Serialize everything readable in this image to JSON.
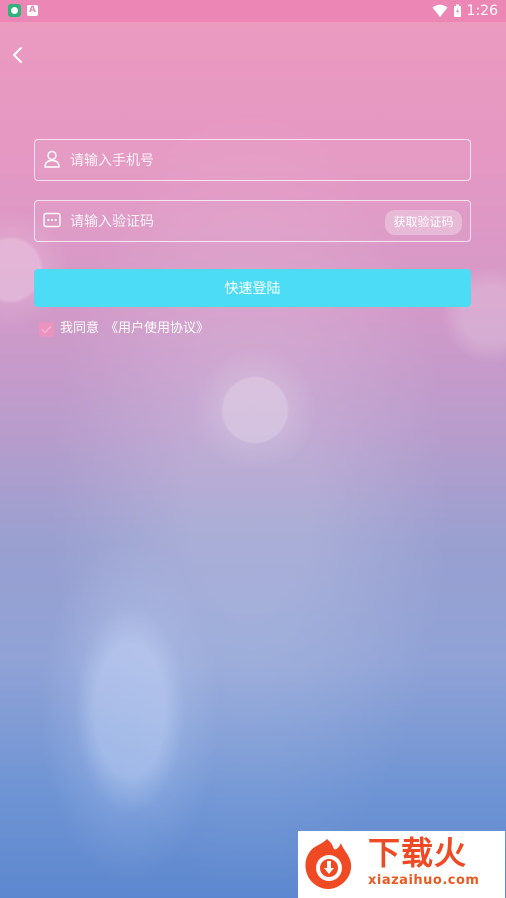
{
  "status_bar": {
    "time": "1:26",
    "left_icons": [
      "app-notification-icon",
      "a-notification-icon"
    ],
    "right_icons": [
      "wifi-icon",
      "battery-icon"
    ]
  },
  "nav": {
    "back_icon": "chevron-left-icon"
  },
  "form": {
    "phone_placeholder": "请输入手机号",
    "phone_icon": "user-icon",
    "code_placeholder": "请输入验证码",
    "code_icon": "message-dots-icon",
    "get_code_label": "获取验证码",
    "login_label": "快速登陆"
  },
  "agreement": {
    "checked": true,
    "prefix": "我同意",
    "link_text": "《用户使用协议》"
  },
  "watermark": {
    "title": "下载火",
    "subtitle": "xiazaihuo.com"
  },
  "colors": {
    "login_button": "#4ddcf6",
    "checkbox": "#ea93be",
    "watermark_text": "#f04a24"
  }
}
